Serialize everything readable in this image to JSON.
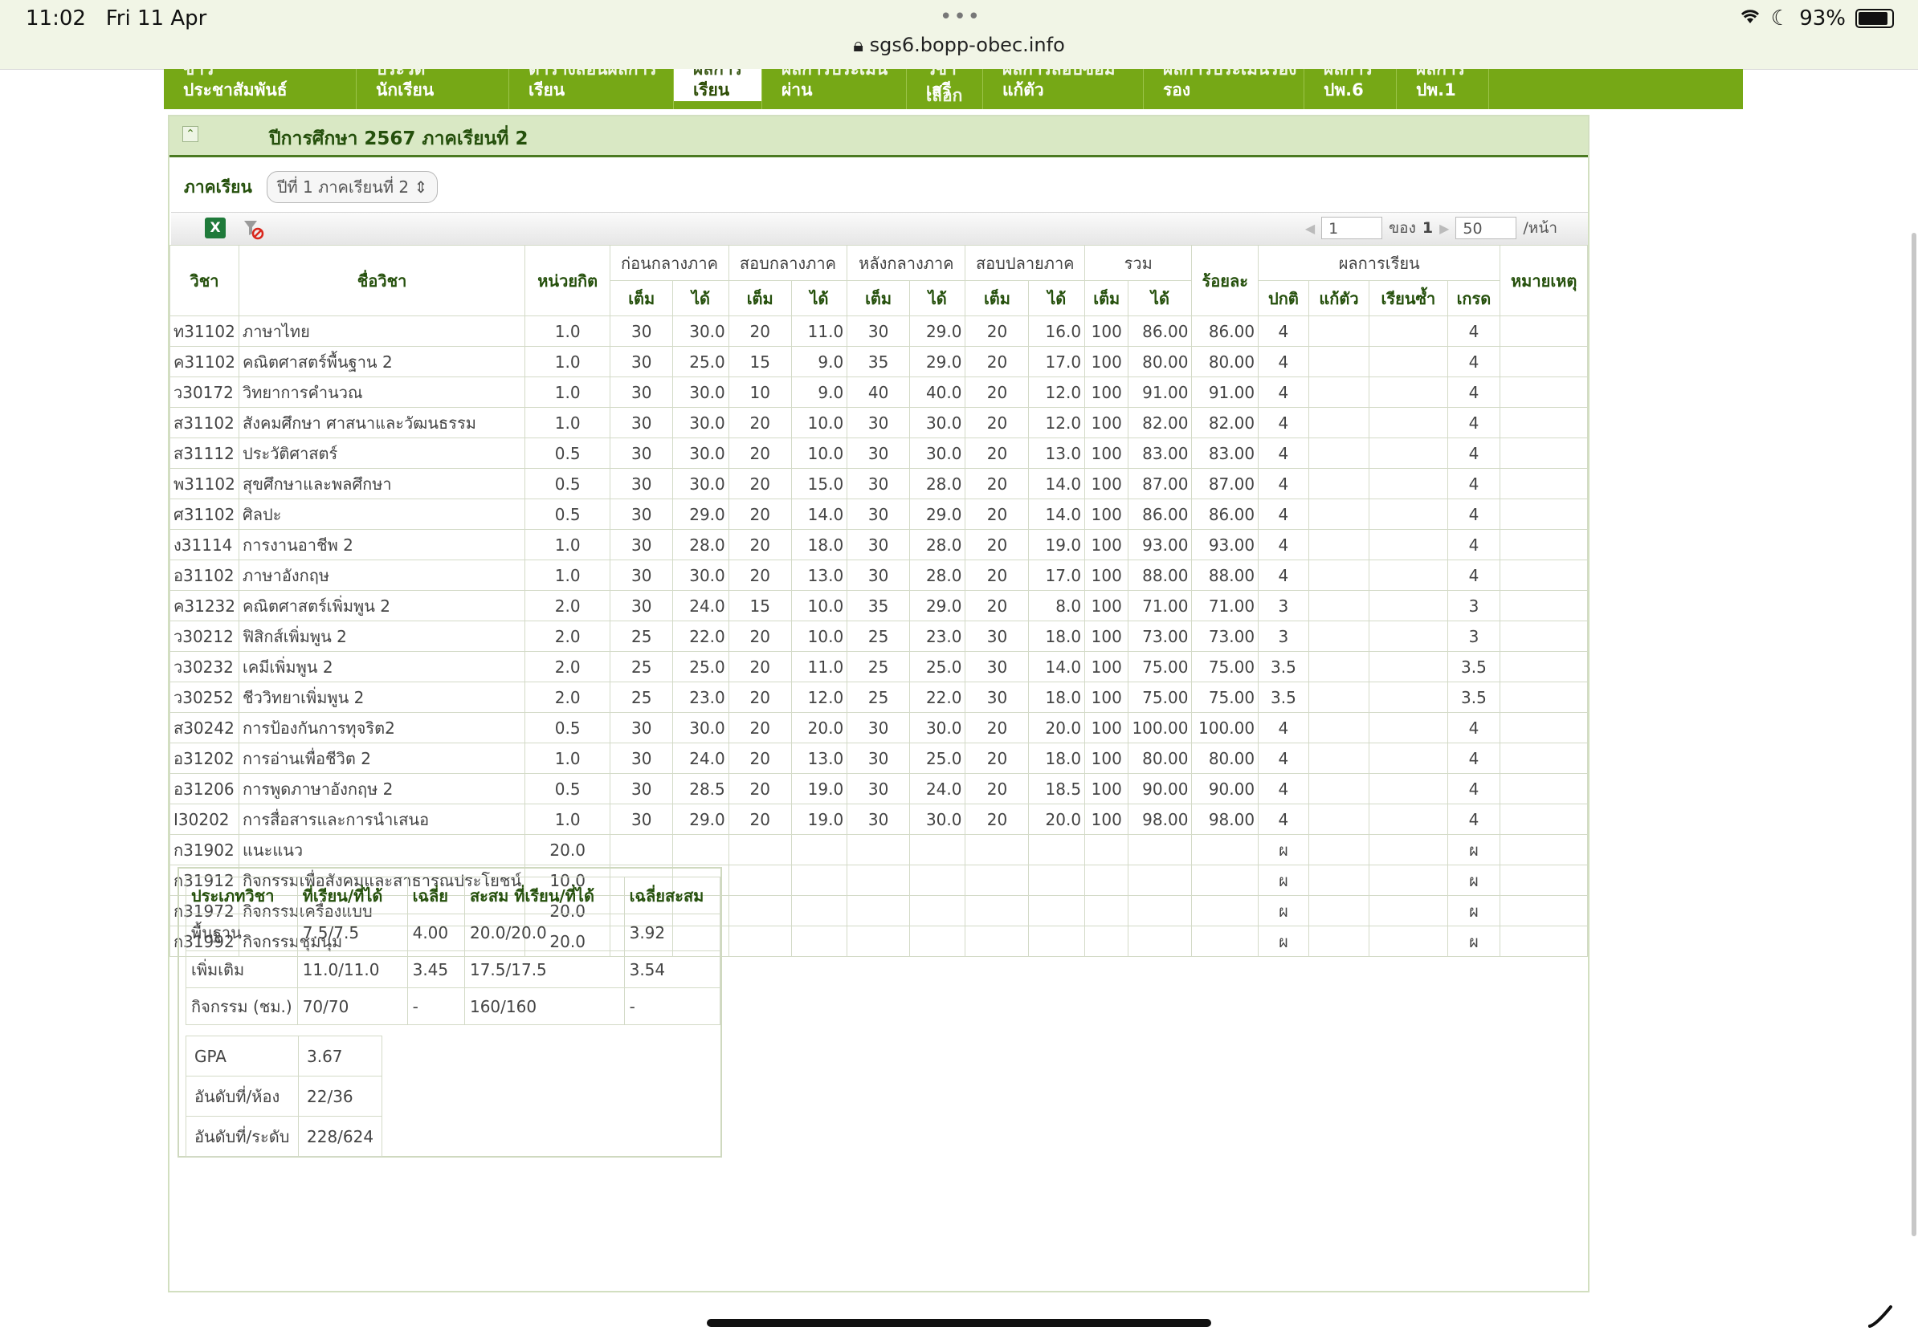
{
  "status_bar": {
    "time": "11:02",
    "date": "Fri 11 Apr",
    "battery": "93%",
    "url": "sgs6.bopp-obec.info",
    "dots": "•••"
  },
  "nav": [
    {
      "top": "ข่าว",
      "bottom": "ประชาสัมพันธ์"
    },
    {
      "top": "ประวัติ",
      "bottom": "นักเรียน"
    },
    {
      "top": "ตารางสอนผลการ",
      "bottom": "เรียน"
    },
    {
      "top": "ผลการ",
      "bottom": "เรียน"
    },
    {
      "top": "ผลการประเมิน",
      "bottom": "ผ่าน"
    },
    {
      "top": "วิชาเลือก",
      "bottom": "เสรี"
    },
    {
      "top": "ผลการสอบซ่อม",
      "bottom": "แก้ตัว"
    },
    {
      "top": "ผลการประเมินรอง",
      "bottom": "รอง"
    },
    {
      "top": "ผลการ",
      "bottom": "ปพ.6"
    },
    {
      "top": "ผลการ",
      "bottom": "ปพ.1"
    }
  ],
  "panel": {
    "collapse_icon": "⌃",
    "title": "ปีการศึกษา 2567 ภาคเรียนที่ 2"
  },
  "term": {
    "label": "ภาคเรียน",
    "selected": "ปีที่ 1 ภาคเรียนที่ 2 ⇕"
  },
  "toolbar": {
    "excel_icon": "X",
    "page_value": "1",
    "of_label": "ของ",
    "total_pages": "1",
    "per_page": "50",
    "per_page_label": "/หน้า"
  },
  "headers": {
    "code": "วิชา",
    "name": "ชื่อวิชา",
    "credit": "หน่วยกิต",
    "before_mid": "ก่อนกลางภาค",
    "mid": "สอบกลางภาค",
    "after_mid": "หลังกลางภาค",
    "final": "สอบปลายภาค",
    "total": "รวม",
    "percent": "ร้อยละ",
    "result": "ผลการเรียน",
    "remark": "หมายเหตุ",
    "full": "เต็ม",
    "got": "ได้",
    "normal": "ปกติ",
    "retake": "แก้ตัว",
    "repeat": "เรียนซ้ำ",
    "grade": "เกรด"
  },
  "rows": [
    [
      "ท31102",
      "ภาษาไทย",
      "1.0",
      "30",
      "30.0",
      "20",
      "11.0",
      "30",
      "29.0",
      "20",
      "16.0",
      "100",
      "86.00",
      "86.00",
      "4",
      "",
      "",
      "4"
    ],
    [
      "ค31102",
      "คณิตศาสตร์พื้นฐาน 2",
      "1.0",
      "30",
      "25.0",
      "15",
      "9.0",
      "35",
      "29.0",
      "20",
      "17.0",
      "100",
      "80.00",
      "80.00",
      "4",
      "",
      "",
      "4"
    ],
    [
      "ว30172",
      "วิทยาการคำนวณ",
      "1.0",
      "30",
      "30.0",
      "10",
      "9.0",
      "40",
      "40.0",
      "20",
      "12.0",
      "100",
      "91.00",
      "91.00",
      "4",
      "",
      "",
      "4"
    ],
    [
      "ส31102",
      "สังคมศึกษา ศาสนาและวัฒนธรรม",
      "1.0",
      "30",
      "30.0",
      "20",
      "10.0",
      "30",
      "30.0",
      "20",
      "12.0",
      "100",
      "82.00",
      "82.00",
      "4",
      "",
      "",
      "4"
    ],
    [
      "ส31112",
      "ประวัติศาสตร์",
      "0.5",
      "30",
      "30.0",
      "20",
      "10.0",
      "30",
      "30.0",
      "20",
      "13.0",
      "100",
      "83.00",
      "83.00",
      "4",
      "",
      "",
      "4"
    ],
    [
      "พ31102",
      "สุขศึกษาและพลศึกษา",
      "0.5",
      "30",
      "30.0",
      "20",
      "15.0",
      "30",
      "28.0",
      "20",
      "14.0",
      "100",
      "87.00",
      "87.00",
      "4",
      "",
      "",
      "4"
    ],
    [
      "ศ31102",
      "ศิลปะ",
      "0.5",
      "30",
      "29.0",
      "20",
      "14.0",
      "30",
      "29.0",
      "20",
      "14.0",
      "100",
      "86.00",
      "86.00",
      "4",
      "",
      "",
      "4"
    ],
    [
      "ง31114",
      "การงานอาชีพ 2",
      "1.0",
      "30",
      "28.0",
      "20",
      "18.0",
      "30",
      "28.0",
      "20",
      "19.0",
      "100",
      "93.00",
      "93.00",
      "4",
      "",
      "",
      "4"
    ],
    [
      "อ31102",
      "ภาษาอังกฤษ",
      "1.0",
      "30",
      "30.0",
      "20",
      "13.0",
      "30",
      "28.0",
      "20",
      "17.0",
      "100",
      "88.00",
      "88.00",
      "4",
      "",
      "",
      "4"
    ],
    [
      "ค31232",
      "คณิตศาสตร์เพิ่มพูน 2",
      "2.0",
      "30",
      "24.0",
      "15",
      "10.0",
      "35",
      "29.0",
      "20",
      "8.0",
      "100",
      "71.00",
      "71.00",
      "3",
      "",
      "",
      "3"
    ],
    [
      "ว30212",
      "ฟิสิกส์เพิ่มพูน 2",
      "2.0",
      "25",
      "22.0",
      "20",
      "10.0",
      "25",
      "23.0",
      "30",
      "18.0",
      "100",
      "73.00",
      "73.00",
      "3",
      "",
      "",
      "3"
    ],
    [
      "ว30232",
      "เคมีเพิ่มพูน 2",
      "2.0",
      "25",
      "25.0",
      "20",
      "11.0",
      "25",
      "25.0",
      "30",
      "14.0",
      "100",
      "75.00",
      "75.00",
      "3.5",
      "",
      "",
      "3.5"
    ],
    [
      "ว30252",
      "ชีววิทยาเพิ่มพูน 2",
      "2.0",
      "25",
      "23.0",
      "20",
      "12.0",
      "25",
      "22.0",
      "30",
      "18.0",
      "100",
      "75.00",
      "75.00",
      "3.5",
      "",
      "",
      "3.5"
    ],
    [
      "ส30242",
      "การป้องกันการทุจริต2",
      "0.5",
      "30",
      "30.0",
      "20",
      "20.0",
      "30",
      "30.0",
      "20",
      "20.0",
      "100",
      "100.00",
      "100.00",
      "4",
      "",
      "",
      "4"
    ],
    [
      "อ31202",
      "การอ่านเพื่อชีวิต 2",
      "1.0",
      "30",
      "24.0",
      "20",
      "13.0",
      "30",
      "25.0",
      "20",
      "18.0",
      "100",
      "80.00",
      "80.00",
      "4",
      "",
      "",
      "4"
    ],
    [
      "อ31206",
      "การพูดภาษาอังกฤษ 2",
      "0.5",
      "30",
      "28.5",
      "20",
      "19.0",
      "30",
      "24.0",
      "20",
      "18.5",
      "100",
      "90.00",
      "90.00",
      "4",
      "",
      "",
      "4"
    ],
    [
      "I30202",
      "การสื่อสารและการนำเสนอ",
      "1.0",
      "30",
      "29.0",
      "20",
      "19.0",
      "30",
      "30.0",
      "20",
      "20.0",
      "100",
      "98.00",
      "98.00",
      "4",
      "",
      "",
      "4"
    ],
    [
      "ก31902",
      "แนะแนว",
      "20.0",
      "",
      "",
      "",
      "",
      "",
      "",
      "",
      "",
      "",
      "",
      "",
      "ผ",
      "",
      "",
      "ผ"
    ],
    [
      "ก31912",
      "กิจกรรมเพื่อสังคมและสาธารณประโยชน์",
      "10.0",
      "",
      "",
      "",
      "",
      "",
      "",
      "",
      "",
      "",
      "",
      "",
      "ผ",
      "",
      "",
      "ผ"
    ],
    [
      "ก31972",
      "กิจกรรมเครื่องแบบ",
      "20.0",
      "",
      "",
      "",
      "",
      "",
      "",
      "",
      "",
      "",
      "",
      "",
      "ผ",
      "",
      "",
      "ผ"
    ],
    [
      "ก31992",
      "กิจกรรมชุมนุม",
      "20.0",
      "",
      "",
      "",
      "",
      "",
      "",
      "",
      "",
      "",
      "",
      "",
      "ผ",
      "",
      "",
      "ผ"
    ]
  ],
  "summary": {
    "headers": [
      "ประเภทวิชา",
      "ที่เรียน/ที่ได้",
      "เฉลี่ย",
      "สะสม ที่เรียน/ที่ได้",
      "เฉลี่ยสะสม"
    ],
    "rows": [
      [
        "พื้นฐาน",
        "7.5/7.5",
        "4.00",
        "20.0/20.0",
        "3.92"
      ],
      [
        "เพิ่มเติม",
        "11.0/11.0",
        "3.45",
        "17.5/17.5",
        "3.54"
      ],
      [
        "กิจกรรม (ชม.)",
        "70/70",
        "-",
        "160/160",
        "-"
      ]
    ],
    "gpa": [
      [
        "GPA",
        "3.67"
      ],
      [
        "อันดับที่/ห้อง",
        "22/36"
      ],
      [
        "อันดับที่/ระดับ",
        "228/624"
      ]
    ]
  }
}
